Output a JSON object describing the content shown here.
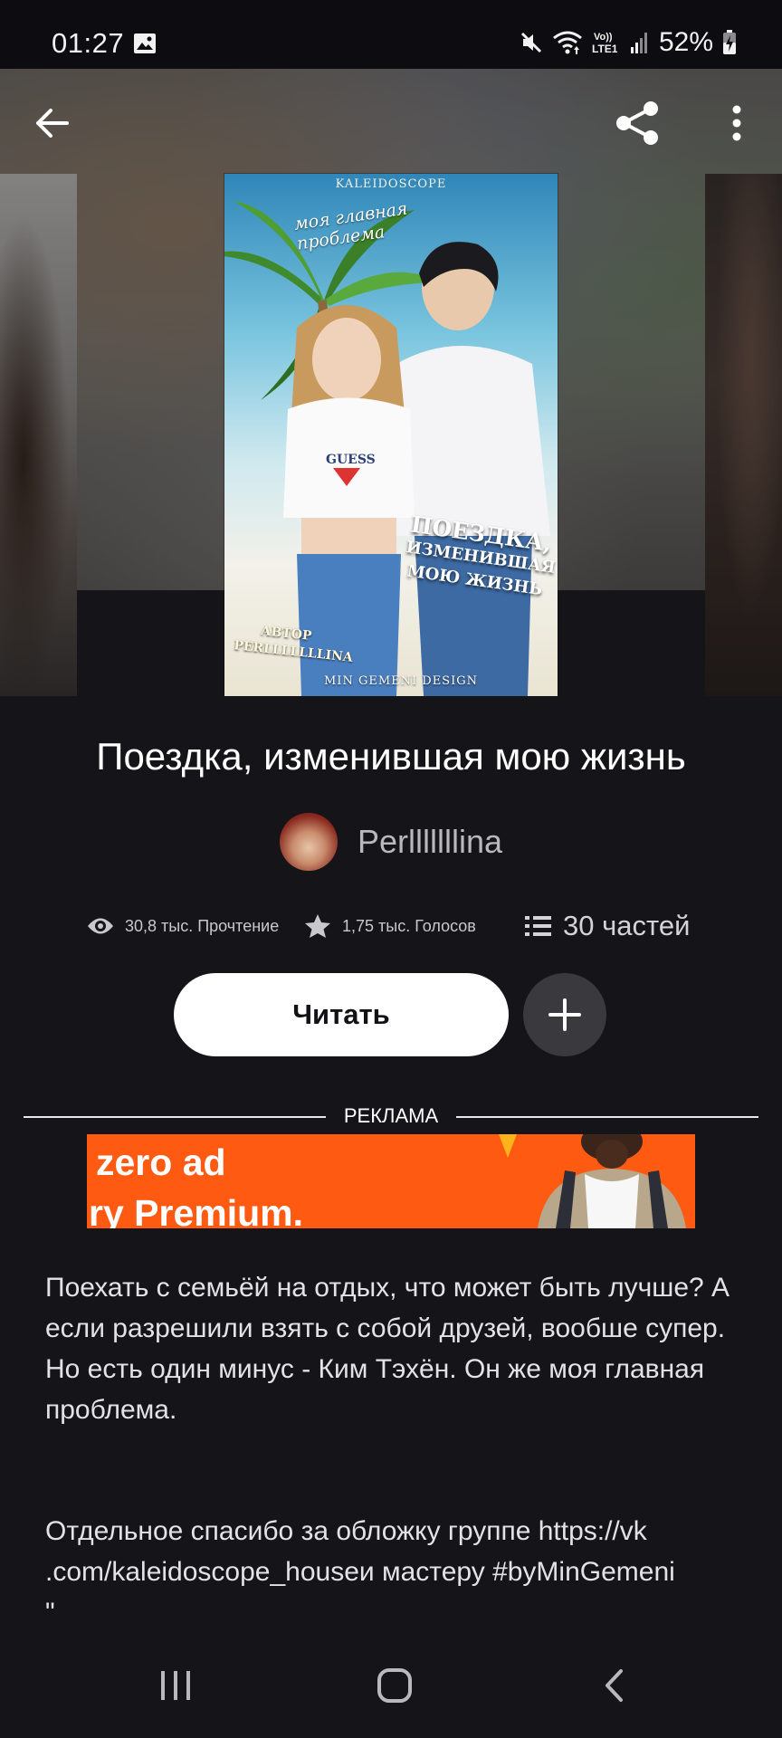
{
  "status_bar": {
    "time": "01:27",
    "battery": "52%",
    "lte_label": "Vo)) LTE1"
  },
  "cover": {
    "brand": "KALEIDOSCOPE",
    "tagline_line1": "моя главная",
    "tagline_line2": "проблема",
    "title_line1": "ПОЕЗДКА,",
    "title_line2": "ИЗМЕНИВШАЯ",
    "title_line3": "МОЮ ЖИЗНЬ",
    "author_label": "АВТОР",
    "author_name": "PERLLLLLLLINA",
    "designer": "MIN GEMENI DESIGN"
  },
  "story": {
    "title": "Поездка, изменившая мою жизнь",
    "author": "Perlllllllina"
  },
  "stats": {
    "reads": "30,8 тыс. Прочтение",
    "votes": "1,75 тыс. Голосов",
    "parts": "30 частей"
  },
  "actions": {
    "read_label": "Читать"
  },
  "ad": {
    "label": "РЕКЛАМА",
    "line1": "zero ad",
    "line2": "ry Premium."
  },
  "description": {
    "text": "Поехать с семьёй на отдых, что может быть лучше? А если разрешили взять с собой друзей, вообше супер. Но есть один минус - Ким Тэхён. Он же моя главная проблема.",
    "thanks_line1": "Отдельное спасибо за обложку группе https://vk",
    "thanks_line2": ".com/kaleidoscope_houseи мастеру #byMinGemeni",
    "thanks_line3": "\""
  },
  "icons": {
    "back": "arrow-left",
    "share": "share",
    "more": "vertical-dots",
    "reads": "eye",
    "votes": "star",
    "parts": "list",
    "add": "plus",
    "nav_recent": "recent-apps",
    "nav_home": "home",
    "nav_back": "back"
  }
}
